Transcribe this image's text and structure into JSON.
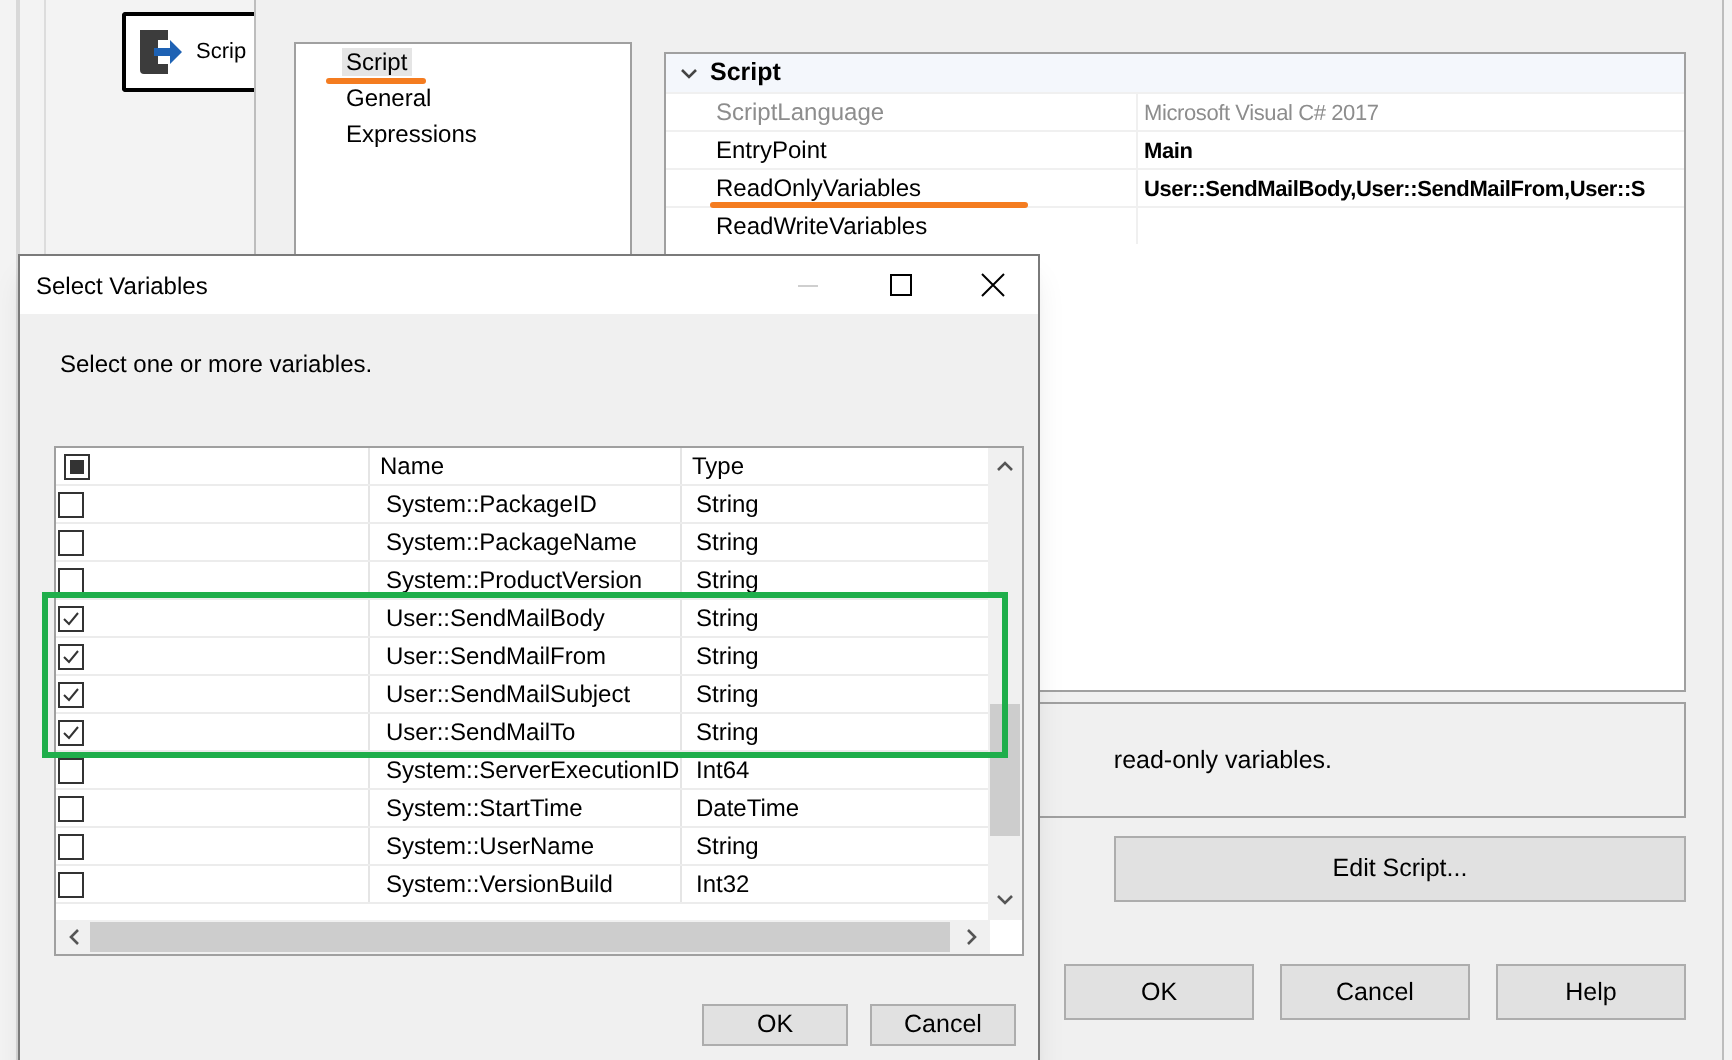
{
  "canvas": {
    "task": {
      "label": "Scrip"
    }
  },
  "editor": {
    "pages": [
      {
        "label": "Script",
        "selected": true
      },
      {
        "label": "General",
        "selected": false
      },
      {
        "label": "Expressions",
        "selected": false
      }
    ],
    "properties": {
      "section": "Script",
      "expanded": true,
      "rows": [
        {
          "name": "ScriptLanguage",
          "value": "Microsoft Visual C# 2017",
          "disabled": true,
          "modified": false
        },
        {
          "name": "EntryPoint",
          "value": "Main",
          "disabled": false,
          "modified": true
        },
        {
          "name": "ReadOnlyVariables",
          "value": "User::SendMailBody,User::SendMailFrom,User::S",
          "disabled": false,
          "modified": true
        },
        {
          "name": "ReadWriteVariables",
          "disabled": false
        }
      ]
    },
    "description": "read-only variables.",
    "edit_button": "Edit Script...",
    "buttons": [
      "OK",
      "Cancel",
      "Help"
    ]
  },
  "dialog": {
    "title": "Select Variables",
    "prompt": "Select one or more variables.",
    "header_checkbox": {
      "partially_checked": true
    },
    "columns": [
      "Name",
      "Type"
    ],
    "rows": [
      {
        "name": "System::PackageID",
        "type": "String",
        "checked": false
      },
      {
        "name": "System::PackageName",
        "type": "String",
        "checked": false
      },
      {
        "name": "System::ProductVersion",
        "type": "String",
        "checked": false
      },
      {
        "name": "User::SendMailBody",
        "type": "String",
        "checked": true
      },
      {
        "name": "User::SendMailFrom",
        "type": "String",
        "checked": true
      },
      {
        "name": "User::SendMailSubject",
        "type": "String",
        "checked": true
      },
      {
        "name": "User::SendMailTo",
        "type": "String",
        "checked": true
      },
      {
        "name": "System::ServerExecutionID",
        "type": "Int64",
        "checked": false
      },
      {
        "name": "System::StartTime",
        "type": "DateTime",
        "checked": false
      },
      {
        "name": "System::UserName",
        "type": "String",
        "checked": false
      },
      {
        "name": "System::VersionBuild",
        "type": "Int32",
        "checked": false
      }
    ],
    "buttons": [
      "OK",
      "Cancel"
    ]
  }
}
